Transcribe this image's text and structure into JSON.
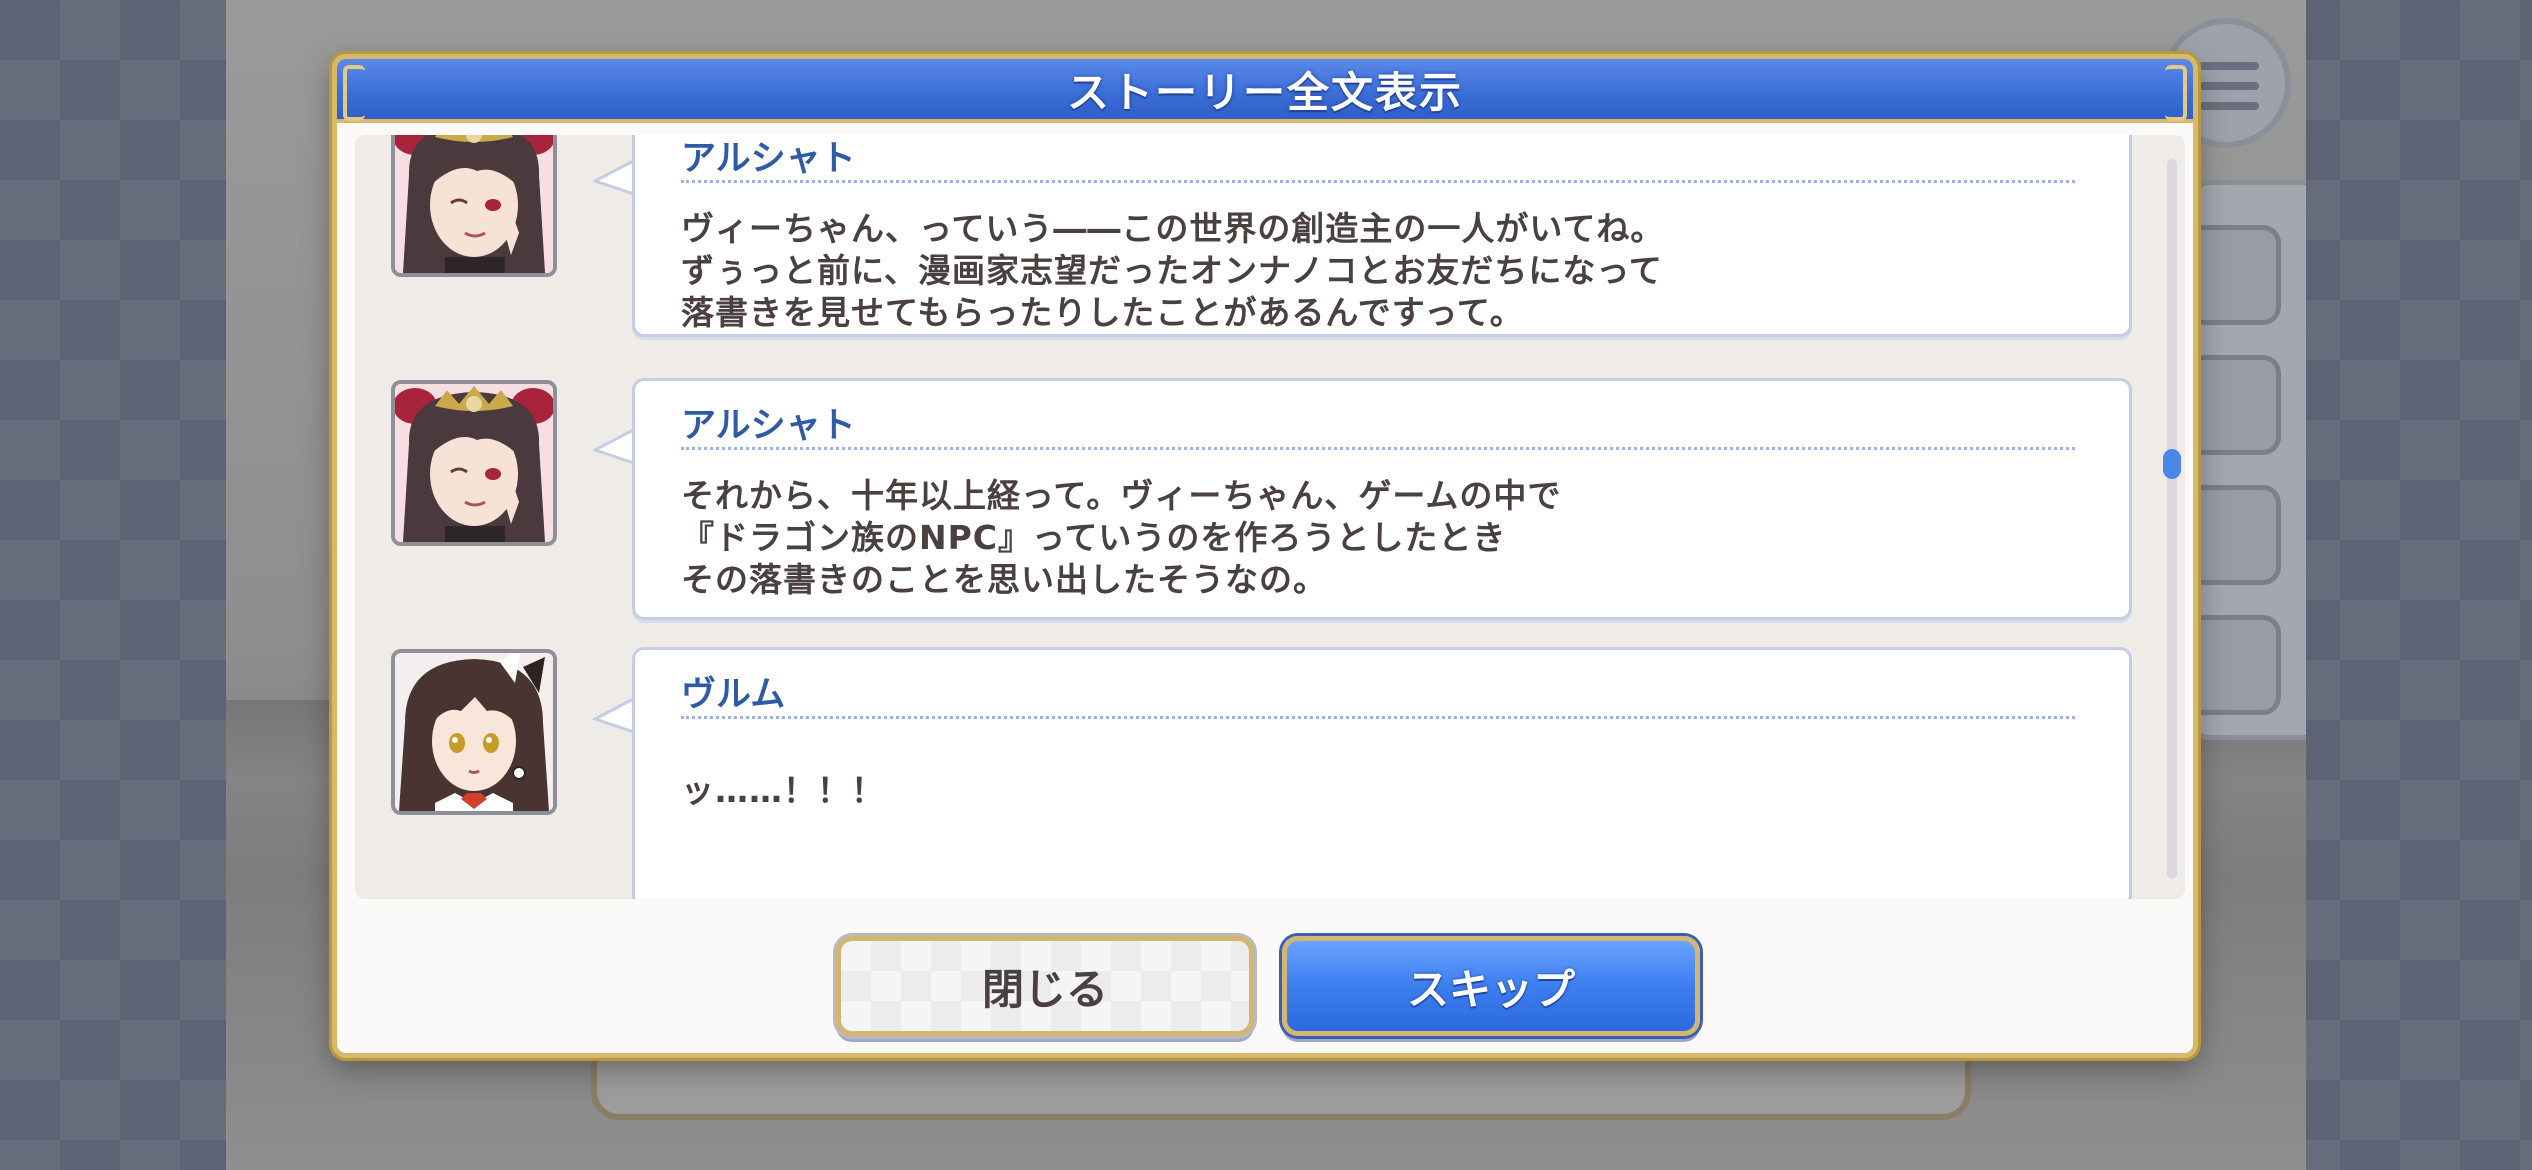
{
  "dialog": {
    "title": "ストーリー全文表示"
  },
  "log": {
    "entries": [
      {
        "speaker": "アルシャト",
        "avatar": "arushat-portrait",
        "lines": [
          "ヴィーちゃん、っていう――この世界の創造主の一人がいてね。",
          "ずぅっと前に、漫画家志望だったオンナノコとお友だちになって",
          "落書きを見せてもらったりしたことがあるんですって。"
        ]
      },
      {
        "speaker": "アルシャト",
        "avatar": "arushat-portrait",
        "lines": [
          "それから、十年以上経って。ヴィーちゃん、ゲームの中で",
          "『ドラゴン族のNPC』っていうのを作ろうとしたとき",
          "その落書きのことを思い出したそうなの。"
        ]
      },
      {
        "speaker": "ヴルム",
        "avatar": "wurm-portrait",
        "lines": [
          "ッ……！！！"
        ]
      }
    ]
  },
  "buttons": {
    "close_label": "閉じる",
    "skip_label": "スキップ"
  },
  "colors": {
    "header_blue": "#3c6fd8",
    "speaker_blue": "#2e5aa8",
    "gold_border": "#d8b86a"
  }
}
